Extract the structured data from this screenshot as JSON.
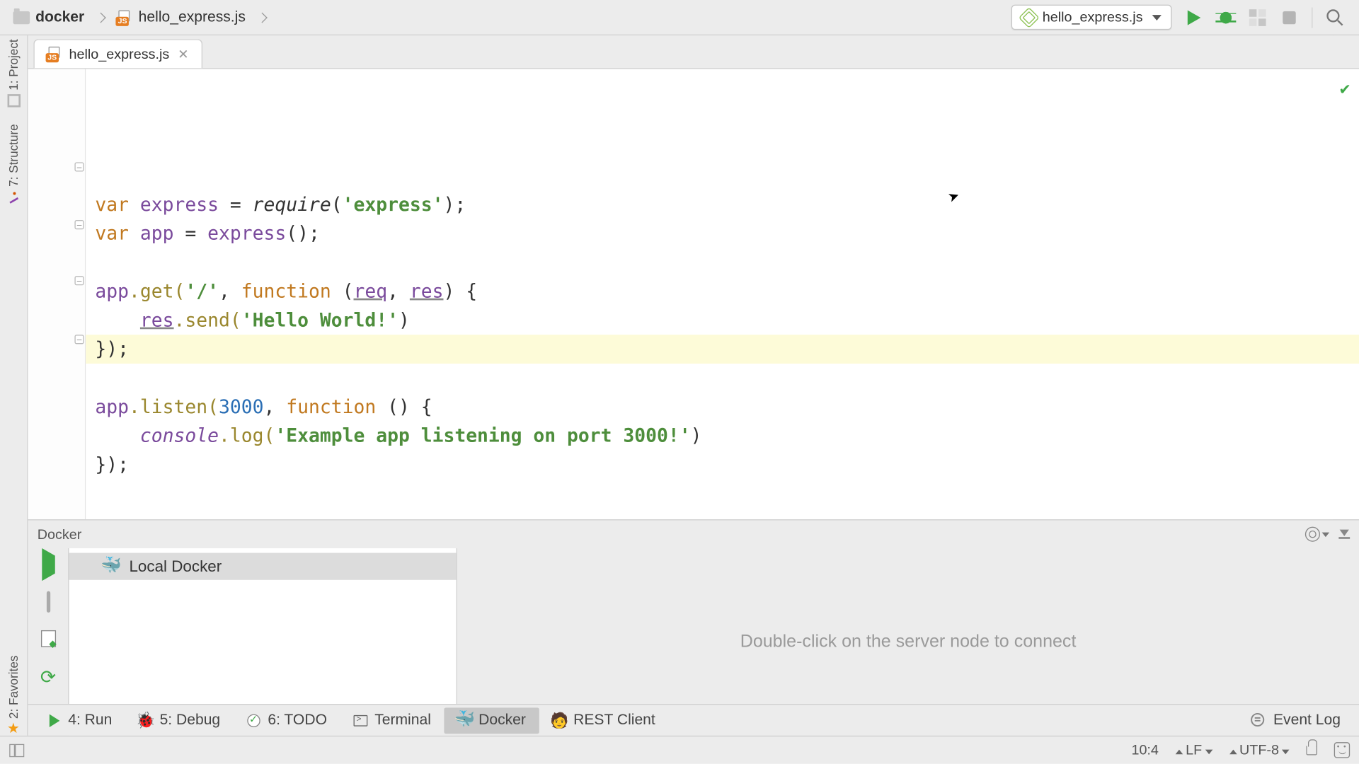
{
  "breadcrumb": {
    "folder": "docker",
    "file": "hello_express.js"
  },
  "run_config": {
    "label": "hello_express.js"
  },
  "left_tools": {
    "project": "1: Project",
    "structure": "7: Structure",
    "favorites": "2: Favorites"
  },
  "tab": {
    "name": "hello_express.js"
  },
  "code": {
    "l1_var": "var ",
    "l1_express": "express",
    "l1_eq": " = ",
    "l1_require": "require",
    "l1_paren": "(",
    "l1_str": "'express'",
    "l1_end": ");",
    "l2_var": "var ",
    "l2_app": "app",
    "l2_eq": " = ",
    "l2_express": "express",
    "l2_call": "();",
    "l4_app": "app",
    "l4_get": ".get(",
    "l4_route": "'/'",
    "l4_comma": ", ",
    "l4_function": "function ",
    "l4_args_open": "(",
    "l4_req": "req",
    "l4_args_sep": ", ",
    "l4_res": "res",
    "l4_args_close": ") {",
    "l5_indent": "    ",
    "l5_res": "res",
    "l5_send": ".send(",
    "l5_str": "'Hello World!'",
    "l5_close": ")",
    "l6": "});",
    "l8_app": "app",
    "l8_listen": ".listen(",
    "l8_port": "3000",
    "l8_comma": ", ",
    "l8_function": "function ",
    "l8_rest": "() {",
    "l9_indent": "    ",
    "l9_console": "console",
    "l9_log": ".log(",
    "l9_str": "'Example app listening on port 3000!'",
    "l9_close": ")",
    "l10": "});"
  },
  "docker": {
    "title": "Docker",
    "tree_item": "Local Docker",
    "hint": "Double-click on the server node to connect"
  },
  "bottom": {
    "run": "4: Run",
    "debug": "5: Debug",
    "todo": "6: TODO",
    "terminal": "Terminal",
    "docker": "Docker",
    "rest": "REST Client",
    "eventlog": "Event Log"
  },
  "status": {
    "pos": "10:4",
    "linesep": "LF",
    "encoding": "UTF-8"
  }
}
